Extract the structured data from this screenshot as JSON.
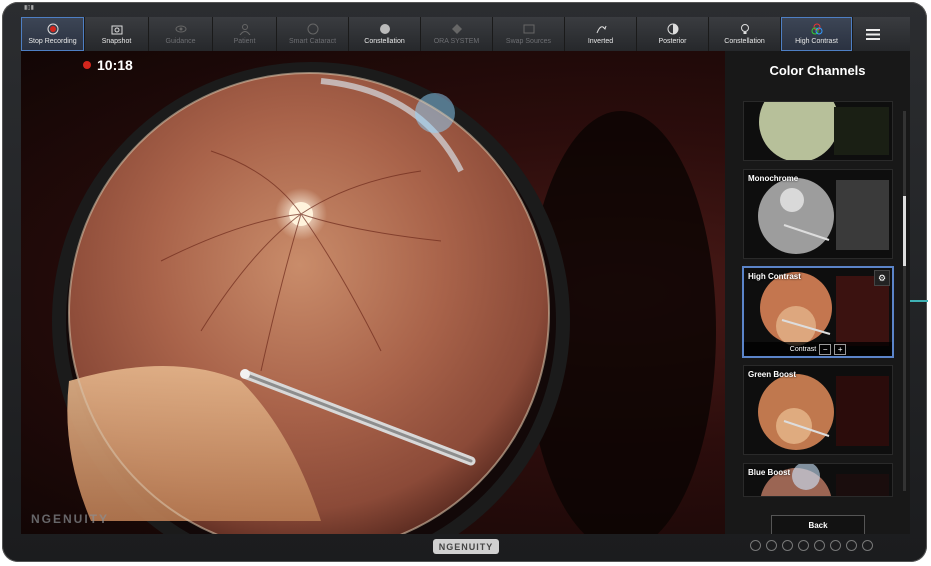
{
  "toolbar": {
    "items": [
      {
        "label": "Stop Recording",
        "icon": "record-icon"
      },
      {
        "label": "Snapshot",
        "icon": "camera-icon"
      },
      {
        "label": "Guidance",
        "icon": "eye-icon"
      },
      {
        "label": "Patient",
        "icon": "person-icon"
      },
      {
        "label": "Smart Cataract",
        "icon": "lens-icon"
      },
      {
        "label": "Constellation",
        "icon": "constellation-icon"
      },
      {
        "label": "ORA SYSTEM",
        "icon": "ora-icon"
      },
      {
        "label": "Swap Sources",
        "icon": "swap-icon"
      },
      {
        "label": "Inverted",
        "icon": "invert-icon"
      },
      {
        "label": "Posterior",
        "icon": "posterior-icon"
      },
      {
        "label": "Constellation",
        "icon": "bulb-icon"
      },
      {
        "label": "High Contrast",
        "icon": "rgb-icon"
      }
    ]
  },
  "video": {
    "timer": "10:18",
    "watermark": "NGENUITY"
  },
  "panel": {
    "title": "Color Channels",
    "cards": [
      {
        "label": ""
      },
      {
        "label": "Monochrome"
      },
      {
        "label": "High Contrast",
        "control_label": "Contrast"
      },
      {
        "label": "Green Boost"
      },
      {
        "label": "Blue Boost"
      }
    ],
    "back_label": "Back"
  },
  "bezel": {
    "logo": "NGENUITY"
  }
}
